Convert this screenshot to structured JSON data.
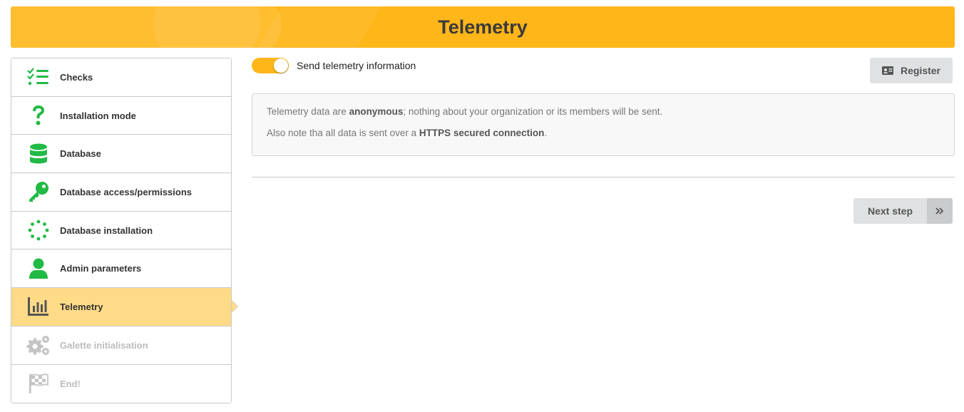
{
  "header": {
    "title": "Telemetry"
  },
  "steps": [
    {
      "label": "Checks",
      "icon": "checklist-icon",
      "state": "done"
    },
    {
      "label": "Installation mode",
      "icon": "question-icon",
      "state": "done"
    },
    {
      "label": "Database",
      "icon": "database-icon",
      "state": "done"
    },
    {
      "label": "Database access/permissions",
      "icon": "key-icon",
      "state": "done"
    },
    {
      "label": "Database installation",
      "icon": "spinner-icon",
      "state": "done"
    },
    {
      "label": "Admin parameters",
      "icon": "user-icon",
      "state": "done"
    },
    {
      "label": "Telemetry",
      "icon": "bar-chart-icon",
      "state": "active"
    },
    {
      "label": "Galette initialisation",
      "icon": "cogs-icon",
      "state": "disabled"
    },
    {
      "label": "End!",
      "icon": "flag-checkered-icon",
      "state": "disabled"
    }
  ],
  "telemetry": {
    "toggle_label": "Send telemetry information",
    "toggle_on": true,
    "register_label": "Register"
  },
  "info": {
    "line1_before": "Telemetry data are ",
    "line1_bold": "anonymous",
    "line1_after": "; nothing about your organization or its members will be sent.",
    "line2_before": "Also note tha all data is sent over a ",
    "line2_bold": "HTTPS secured connection",
    "line2_after": "."
  },
  "footer": {
    "next_label": "Next step"
  },
  "colors": {
    "accent": "#ffb619",
    "done": "#21ba45",
    "active_step": "#ffdb87"
  }
}
